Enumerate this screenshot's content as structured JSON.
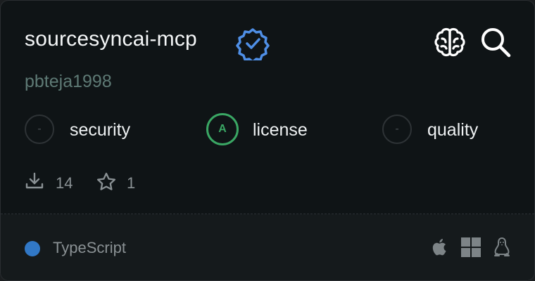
{
  "package": {
    "name": "sourcesyncai-mcp",
    "author": "pbteja1998",
    "verified_icon": "verified-badge-icon"
  },
  "actions": {
    "brain_icon": "brain-icon",
    "search_icon": "search-icon"
  },
  "grades": [
    {
      "label": "security",
      "grade": "-"
    },
    {
      "label": "license",
      "grade": "A"
    },
    {
      "label": "quality",
      "grade": "-"
    }
  ],
  "stats": {
    "downloads": "14",
    "stars": "1"
  },
  "footer": {
    "language": "TypeScript",
    "language_color": "#3178c6",
    "platforms": [
      "apple-icon",
      "windows-icon",
      "linux-icon"
    ]
  },
  "colors": {
    "verified": "#4f8fe6",
    "grade_good": "#3aa764"
  }
}
